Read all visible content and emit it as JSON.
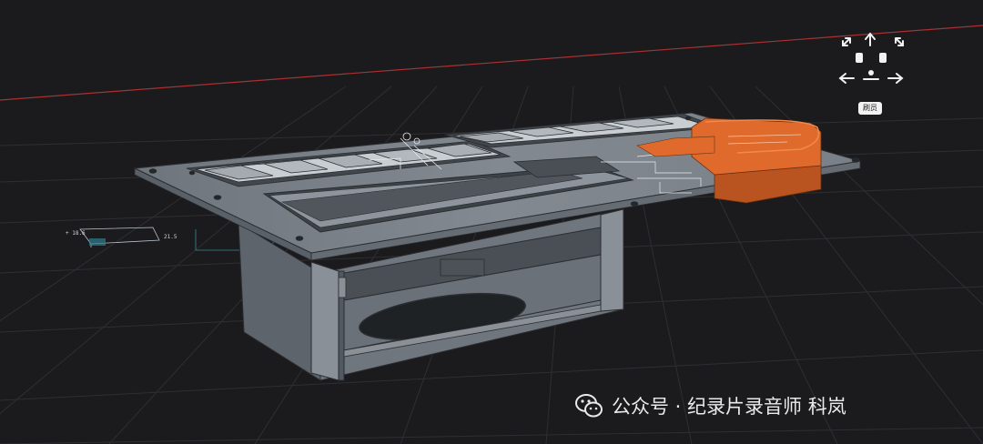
{
  "viewport": {
    "background_color": "#1b1b1d",
    "grid_color": "#2f2f33",
    "axis_color": "#a83232",
    "model_body_color": "#7d838a",
    "model_edge_color": "#2a2d31",
    "selected_part_color": "#e06a2c"
  },
  "nav_cube": {
    "label": "刷员",
    "icons": [
      "arrow-up-icon",
      "arrow-left-icon",
      "arrow-right-icon",
      "expand-diagonal-icon",
      "rotate-cube-icon"
    ]
  },
  "watermark": {
    "icon": "wechat-icon",
    "text": "公众号 · 纪录片录音师 科岚"
  }
}
